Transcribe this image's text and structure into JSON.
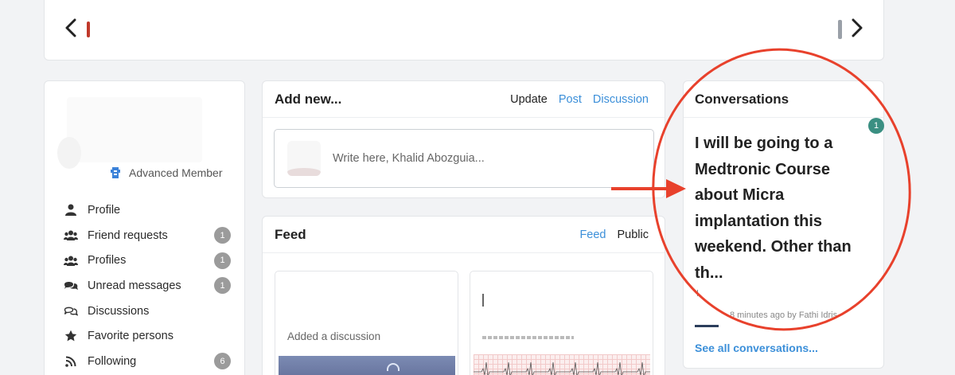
{
  "carousel": {
    "prev_icon": "chevron-left-icon",
    "next_icon": "chevron-right-icon"
  },
  "sidebar": {
    "rank": "Advanced Member",
    "rank_icon": "member-rank-icon",
    "items": [
      {
        "label": "Profile",
        "icon": "user-icon",
        "badge": ""
      },
      {
        "label": "Friend requests",
        "icon": "users-icon",
        "badge": "1"
      },
      {
        "label": "Profiles",
        "icon": "users-icon",
        "badge": "1"
      },
      {
        "label": "Unread messages",
        "icon": "chat-bubbles-icon",
        "badge": "1"
      },
      {
        "label": "Discussions",
        "icon": "discussions-icon",
        "badge": ""
      },
      {
        "label": "Favorite persons",
        "icon": "star-icon",
        "badge": ""
      },
      {
        "label": "Following",
        "icon": "rss-icon",
        "badge": "6"
      }
    ]
  },
  "add_new": {
    "title": "Add new...",
    "tabs": [
      "Update",
      "Post",
      "Discussion"
    ],
    "placeholder": "Write here, Khalid Abozguia..."
  },
  "feed": {
    "title": "Feed",
    "tabs": [
      "Feed",
      "Public"
    ],
    "card1_text": "Added a discussion"
  },
  "conversations": {
    "title": "Conversations",
    "unread_count": "1",
    "message": "I will be going to a Medtronic Course about Micra implantation this weekend. Other than th...",
    "meta": "8 minutes ago by Fathi Idris",
    "see_all": "See all conversations..."
  },
  "annotation": {
    "color": "#e8412c",
    "type": "red-ellipse-and-arrow"
  }
}
